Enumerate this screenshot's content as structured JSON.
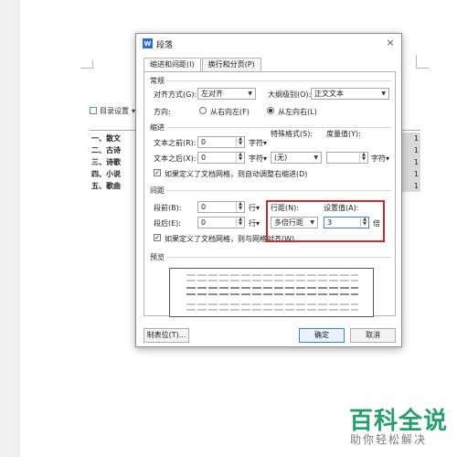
{
  "background": {
    "toc_toolbar_label": "目录设置",
    "toc_lines": [
      {
        "num": "一、",
        "text": "散文",
        "page": "1"
      },
      {
        "num": "二、",
        "text": "古诗",
        "page": "1"
      },
      {
        "num": "三、",
        "text": "诗歌",
        "page": "1"
      },
      {
        "num": "四、",
        "text": "小说",
        "page": "1"
      },
      {
        "num": "五、",
        "text": "歌曲",
        "page": "1"
      }
    ]
  },
  "dialog": {
    "app_icon": "W",
    "title": "段落",
    "close_glyph": "×",
    "tabs": [
      {
        "label": "缩进和间距(I)",
        "active": true
      },
      {
        "label": "换行和分页(P)",
        "active": false
      }
    ],
    "general": {
      "section_title": "常规",
      "align_label": "对齐方式(G):",
      "align_value": "左对齐",
      "outline_label": "大纲级别(O):",
      "outline_value": "正文文本",
      "direction_label": "方向:",
      "rtl_label": "从右向左(F)",
      "ltr_label": "从左向右(L)",
      "selected_direction": "ltr"
    },
    "indent": {
      "section_title": "缩进",
      "before_label": "文本之前(R):",
      "before_value": "0",
      "after_label": "文本之后(X):",
      "after_value": "0",
      "unit": "字符",
      "special_label": "特殊格式(S):",
      "special_value": "(无)",
      "measure_label": "度量值(Y):",
      "measure_value": "",
      "grid_checkbox_label": "如果定义了文档网格，则自动调整右缩进(D)",
      "grid_checked": true
    },
    "spacing": {
      "section_title": "间距",
      "before_label": "段前(B):",
      "before_value": "0",
      "after_label": "段后(E):",
      "after_value": "0",
      "unit": "行",
      "line_spacing_label": "行距(N):",
      "line_spacing_value": "多倍行距",
      "set_value_label": "设置值(A):",
      "set_value": "3",
      "set_value_unit": "倍",
      "grid_checkbox_label": "如果定义了文档网格，则与网格对齐(W)",
      "grid_checked": true
    },
    "preview": {
      "section_title": "预览"
    },
    "buttons": {
      "tabs_label": "制表位(T)...",
      "ok_label": "确定",
      "cancel_label": "取消"
    }
  },
  "watermark": {
    "brand": "百科全说",
    "slogan": "助你轻松解决"
  },
  "colors": {
    "highlight": "#d22a2a",
    "brand_green": "#26a06a",
    "focus_blue": "#3c7fd8"
  }
}
